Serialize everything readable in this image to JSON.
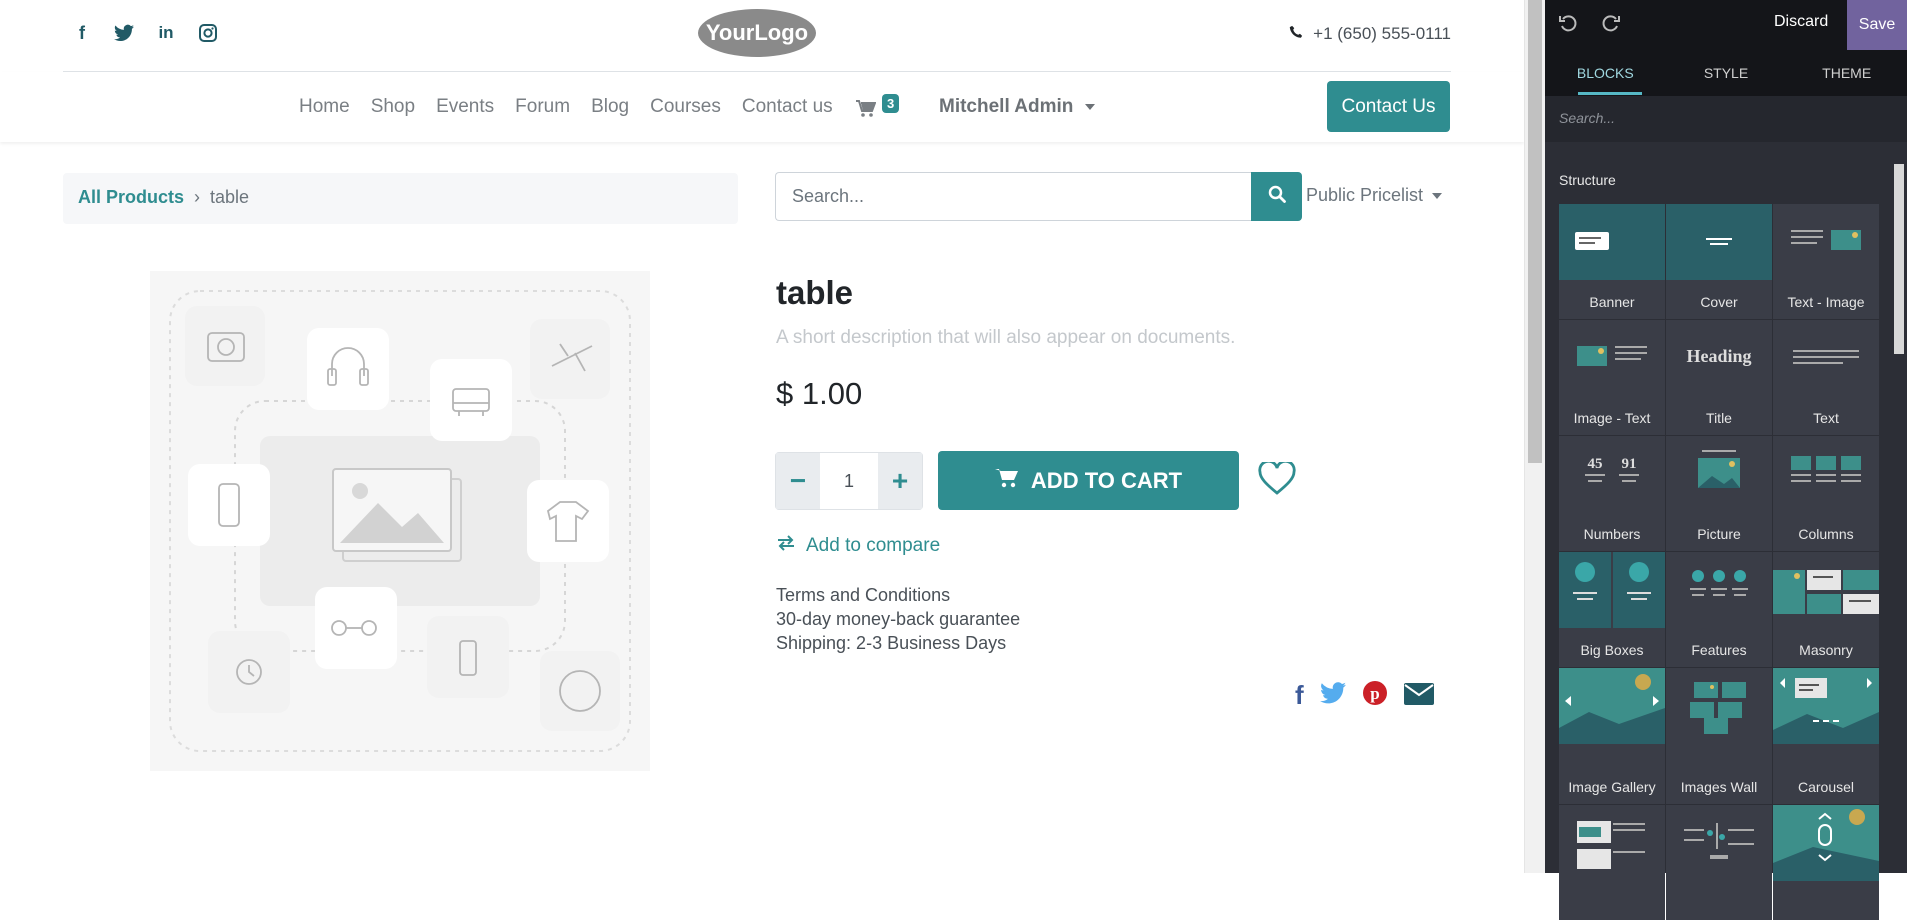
{
  "site": {
    "social": [
      "facebook-icon",
      "twitter-icon",
      "linkedin-icon",
      "instagram-icon"
    ],
    "logo_text": "YourLogo",
    "phone": "+1 (650) 555-0111",
    "menu": [
      "Home",
      "Shop",
      "Events",
      "Forum",
      "Blog",
      "Courses",
      "Contact us"
    ],
    "cart_count": "3",
    "user": "Mitchell Admin",
    "contact_button": "Contact Us",
    "breadcrumb": {
      "parent": "All Products",
      "current": "table"
    },
    "search_placeholder": "Search...",
    "pricelist": "Public Pricelist",
    "product": {
      "name": "table",
      "description": "A short description that will also appear on documents.",
      "price": "$ 1.00",
      "quantity": "1",
      "add_to_cart": "ADD TO CART",
      "compare": "Add to compare",
      "terms": [
        "Terms and Conditions",
        "30-day money-back guarantee",
        "Shipping: 2-3 Business Days"
      ]
    },
    "share": [
      "facebook-share-icon",
      "twitter-share-icon",
      "pinterest-share-icon",
      "email-share-icon"
    ],
    "colors": {
      "primary": "#2f8d90",
      "navy": "#215a66"
    }
  },
  "editor": {
    "discard": "Discard",
    "save": "Save",
    "tabs": [
      "BLOCKS",
      "STYLE",
      "THEME"
    ],
    "search_placeholder": "Search...",
    "section": "Structure",
    "blocks": [
      "Banner",
      "Cover",
      "Text - Image",
      "Image - Text",
      "Title",
      "Text",
      "Numbers",
      "Picture",
      "Columns",
      "Big Boxes",
      "Features",
      "Masonry",
      "Image Gallery",
      "Images Wall",
      "Carousel"
    ],
    "colors": {
      "save_bg": "#71639e",
      "panel_bg": "#2c2e36"
    }
  }
}
